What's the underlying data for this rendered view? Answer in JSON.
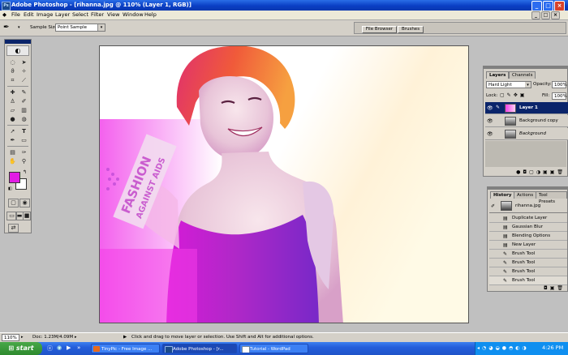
{
  "window": {
    "title": "Adobe Photoshop - [rihanna.jpg @ 110% (Layer 1, RGB)]"
  },
  "menu": [
    "File",
    "Edit",
    "Image",
    "Layer",
    "Select",
    "Filter",
    "View",
    "Window",
    "Help"
  ],
  "options": {
    "sample_size_label": "Sample Size:",
    "sample_size_value": "Point Sample"
  },
  "palette_well": {
    "tabs": [
      "File Browser",
      "Brushes"
    ]
  },
  "canvas_text": {
    "line1": "FASHION",
    "line2": "AGAINST AIDS"
  },
  "layers_panel": {
    "tabs": [
      "Layers",
      "Channels"
    ],
    "blend_mode": "Hard Light",
    "opacity_label": "Opacity:",
    "opacity_value": "100%",
    "lock_label": "Lock:",
    "fill_label": "Fill:",
    "fill_value": "100%",
    "layers": [
      {
        "name": "Layer 1",
        "selected": true
      },
      {
        "name": "Background copy",
        "selected": false
      },
      {
        "name": "Background",
        "selected": false
      }
    ]
  },
  "history_panel": {
    "tabs": [
      "History",
      "Actions",
      "Tool Presets"
    ],
    "snapshot": "rihanna.jpg",
    "items": [
      "Duplicate Layer",
      "Gaussian Blur",
      "Blending Options",
      "New Layer",
      "Brush Tool",
      "Brush Tool",
      "Brush Tool",
      "Brush Tool"
    ]
  },
  "status": {
    "zoom": "110%",
    "doc": "Doc: 1.23M/4.09M",
    "hint": "Click and drag to move layer or selection.  Use Shift and Alt for additional options."
  },
  "taskbar": {
    "start": "start",
    "tasks": [
      "TinyPic - Free Image ...",
      "Adobe Photoshop - [r...",
      "Tutorial - WordPad"
    ],
    "clock": "4:26 PM"
  },
  "colors": {
    "foreground": "#e21ce4",
    "background": "#ffffff",
    "title_blue": "#0a3fc4",
    "layer_selected": "#0a246a"
  }
}
